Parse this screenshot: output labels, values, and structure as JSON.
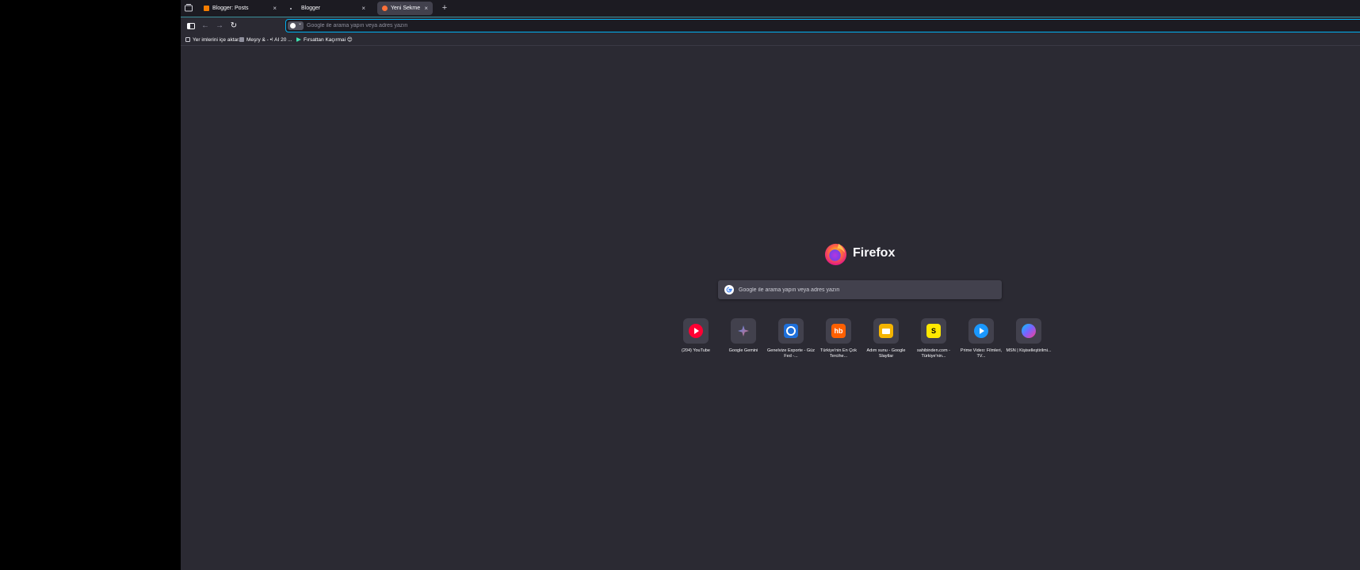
{
  "tabs": [
    {
      "label": "Blogger: Posts",
      "close": "×",
      "favicon_color": "#f57d00"
    },
    {
      "label": "Blogger",
      "close": "×",
      "favicon_color": "#1c1b22"
    },
    {
      "label": "Yeni Sekme",
      "close": "×",
      "favicon_color": "#ff7139"
    }
  ],
  "new_tab_glyph": "+",
  "nav": {
    "sidebar_icon": "sidebar-icon",
    "back_glyph": "←",
    "forward_glyph": "→",
    "reload_glyph": "↻",
    "url_placeholder": "Google ile arama yapın veya adres yazın"
  },
  "bookmarks": [
    {
      "label": "Yer imlerini içe aktar...",
      "icon": "import-icon"
    },
    {
      "label": "Meşry & - •! AI 20 ...",
      "icon": "bookmark-icon"
    },
    {
      "label": "Fırsattan Kaçırmai 😊",
      "icon": "play-icon"
    }
  ],
  "ntp": {
    "brand": "Firefox",
    "search_placeholder": "Google ile arama yapın veya adres yazın",
    "shortcuts": [
      {
        "label": "(204) YouTube",
        "icon": "youtube-icon",
        "color": "#ff0033"
      },
      {
        "label": "Google Gemini",
        "icon": "gemini-icon",
        "color": "#4e8df5"
      },
      {
        "label": "Genelvize Exporte - Güz Fed -...",
        "icon": "outlook-icon",
        "color": "#1e6fd9"
      },
      {
        "label": "Türkiye'nin En Çok Tercihe...",
        "icon": "hepsiburada-icon",
        "color": "#ff6000",
        "text": "hb"
      },
      {
        "label": "Adım sunu - Google Slaytlar",
        "icon": "slides-icon",
        "color": "#f4b400"
      },
      {
        "label": "sahibinden.com - Türkiye'nin...",
        "icon": "sahibinden-icon",
        "color": "#ffe800",
        "text": "S"
      },
      {
        "label": "Prime Video: Filmleri, TV...",
        "icon": "prime-video-icon",
        "color": "#1a98ff"
      },
      {
        "label": "MSN | Kişiselleştirilmi...",
        "icon": "msn-icon",
        "color": "#7b61ff"
      }
    ]
  }
}
